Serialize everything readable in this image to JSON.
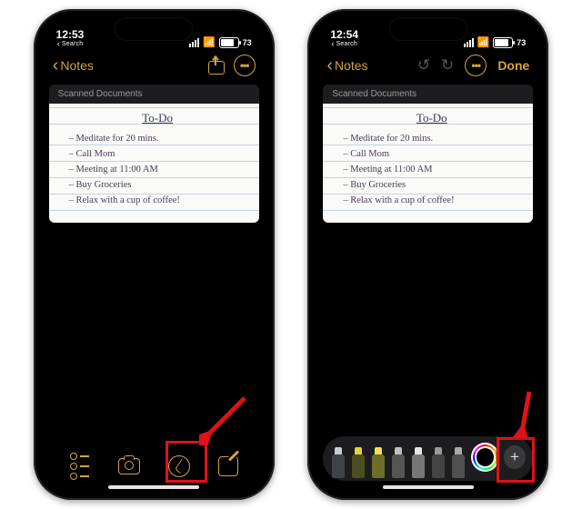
{
  "left": {
    "status": {
      "time": "12:53",
      "search": "Search",
      "battery_pct": 73,
      "battery_label": "73"
    },
    "nav": {
      "back": "Notes"
    },
    "doc": {
      "header": "Scanned Documents",
      "title": "To-Do",
      "lines": [
        "Meditate for 20 mins.",
        "Call Mom",
        "Meeting at 11:00 AM",
        "Buy Groceries",
        "Relax with a cup of coffee!"
      ]
    }
  },
  "right": {
    "status": {
      "time": "12:54",
      "search": "Search",
      "battery_pct": 73,
      "battery_label": "73"
    },
    "nav": {
      "back": "Notes",
      "done": "Done"
    },
    "doc": {
      "header": "Scanned Documents",
      "title": "To-Do",
      "lines": [
        "Meditate for 20 mins.",
        "Call Mom",
        "Meeting at 11:00 AM",
        "Buy Groceries",
        "Relax with a cup of coffee!"
      ]
    },
    "tools": [
      {
        "name": "pen",
        "tip": "#c9cdd2",
        "body": "#3f4348"
      },
      {
        "name": "marker",
        "tip": "#e6d13b",
        "body": "#4d4d22"
      },
      {
        "name": "highlighter",
        "tip": "#f2e34b",
        "body": "#6e6e2b"
      },
      {
        "name": "pencil",
        "tip": "#bfbfbf",
        "body": "#555"
      },
      {
        "name": "eraser",
        "tip": "#e6e6e6",
        "body": "#777"
      },
      {
        "name": "lasso",
        "tip": "#999",
        "body": "#444"
      },
      {
        "name": "ruler",
        "tip": "#aaa",
        "body": "#505050"
      }
    ]
  }
}
